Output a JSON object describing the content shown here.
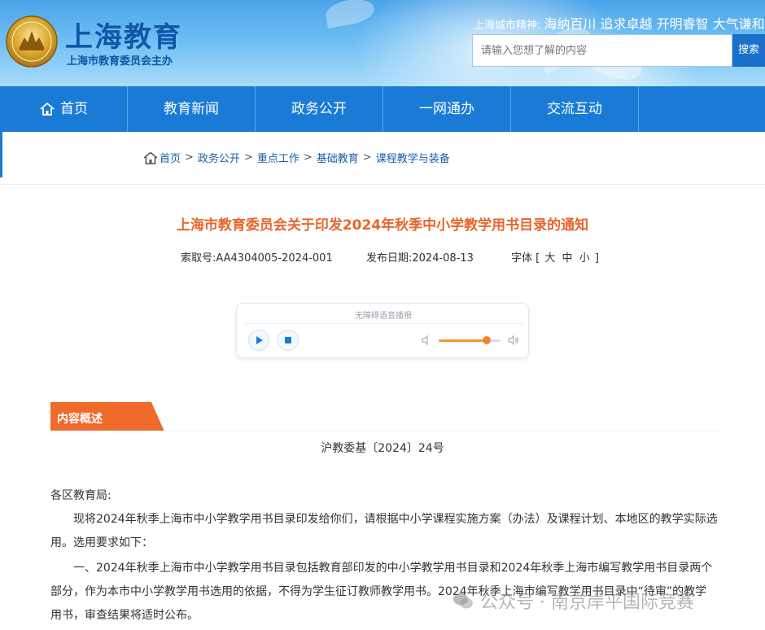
{
  "header": {
    "site_title": "上海教育",
    "site_subtitle": "上海市教育委员会主办",
    "motto_label": "上海城市精神:",
    "motto_text": "海纳百川 追求卓越 开明睿智 大气谦和",
    "search_placeholder": "请输入您想了解的内容",
    "search_button": "搜索"
  },
  "nav": {
    "items": [
      {
        "label": "首页"
      },
      {
        "label": "教育新闻"
      },
      {
        "label": "政务公开"
      },
      {
        "label": "一网通办"
      },
      {
        "label": "交流互动"
      }
    ]
  },
  "breadcrumb": [
    "首页",
    "政务公开",
    "重点工作",
    "基础教育",
    "课程教学与装备"
  ],
  "article": {
    "title": "上海市教育委员会关于印发2024年秋季中小学教学用书目录的通知",
    "index_label": "索取号:",
    "index_value": "AA4304005-2024-001",
    "date_label": "发布日期:",
    "date_value": "2024-08-13",
    "font_label": "字体",
    "font_sizes": [
      "大",
      "中",
      "小"
    ]
  },
  "player": {
    "label": "无障碍语音播报",
    "volume": 0.78
  },
  "summary": {
    "tab_label": "内容概述",
    "doc_number": "沪教委基〔2024〕24号",
    "salutation": "各区教育局:",
    "para1": "现将2024年秋季上海市中小学教学用书目录印发给你们，请根据中小学课程实施方案（办法）及课程计划、本地区的教学实际选用。选用要求如下：",
    "para2": "一、2024年秋季上海市中小学教学用书目录包括教育部印发的中小学教学用书目录和2024年秋季上海市编写教学用书目录两个部分，作为本市中小学教学用书选用的依据，不得为学生征订教师教学用书。2024年秋季上海市编写教学用书目录中“待审”的教学用书，审查结果将适时公布。"
  },
  "watermark": "公众号 · 南京岸平国际竞赛",
  "colors": {
    "nav_blue": "#1a7bd6",
    "title_orange": "#e8652b",
    "tab_orange": "#ef6a2b",
    "link_blue": "#1a5fa8"
  }
}
